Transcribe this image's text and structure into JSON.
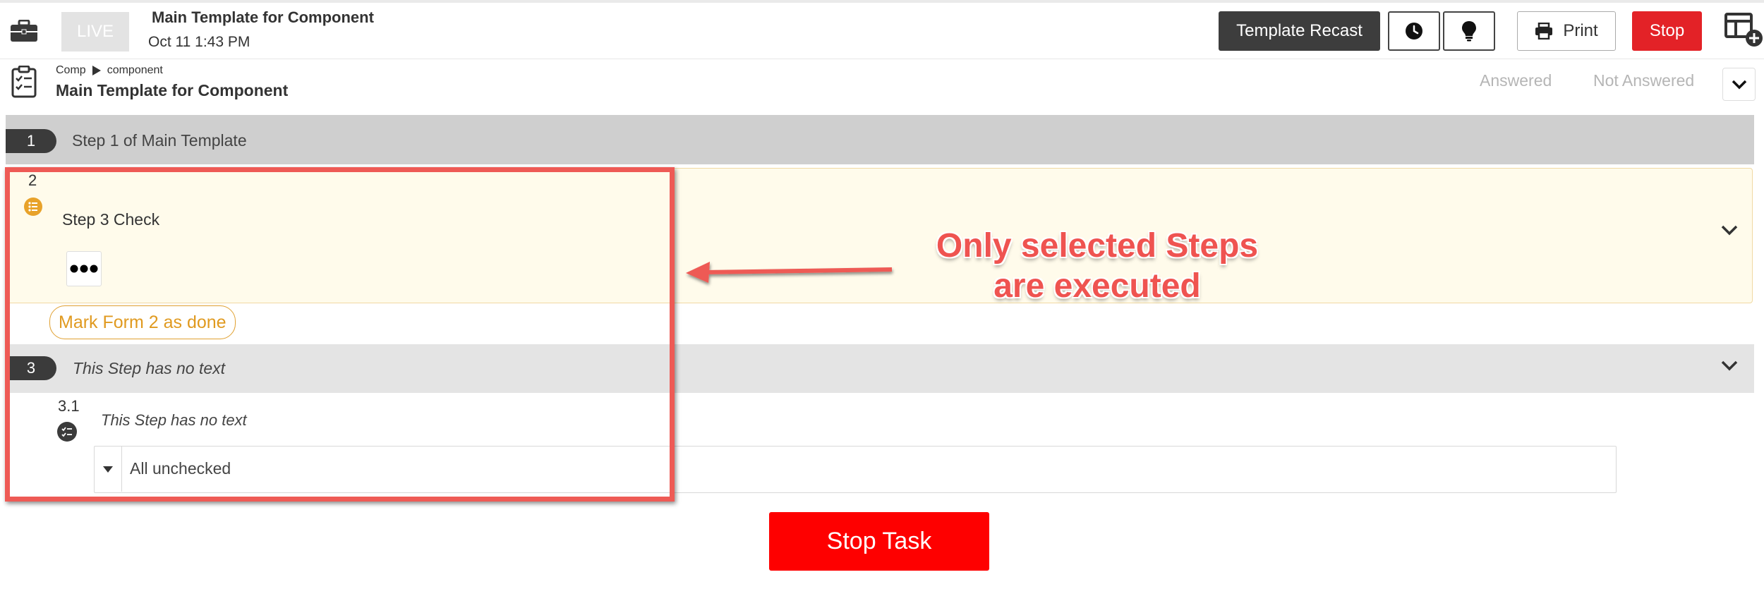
{
  "header": {
    "live_label": "LIVE",
    "title": "Main Template for Component",
    "date": "Oct 11 1:43 PM",
    "recast_label": "Template Recast",
    "print_label": "Print",
    "stop_label": "Stop"
  },
  "subheader": {
    "breadcrumb": {
      "root": "Comp",
      "child": "component"
    },
    "title": "Main Template for Component",
    "answered_label": "Answered",
    "not_answered_label": "Not Answered"
  },
  "steps": {
    "step1": {
      "number": "1",
      "text": "Step 1 of Main Template"
    },
    "step2": {
      "number": "2",
      "text": "Step 3 Check",
      "mark_done_label": "Mark Form 2 as done"
    },
    "step3": {
      "number": "3",
      "text": "This Step has no text"
    },
    "step31": {
      "number": "3.1",
      "text": "This Step has no text",
      "select_value": "All unchecked"
    }
  },
  "footer": {
    "stop_task_label": "Stop Task"
  },
  "annotation": {
    "line1": "Only selected Steps",
    "line2": "are executed"
  },
  "colors": {
    "stop_red": "#e32227",
    "stop_task_red": "#fe0000",
    "annotation_red": "#ef5350",
    "step2_accent": "#e09a20"
  },
  "icons": [
    "briefcase-icon",
    "clock-icon",
    "lightbulb-icon",
    "printer-icon",
    "layout-add-icon",
    "clipboard-icon",
    "play-icon",
    "chevron-down-icon",
    "list-icon",
    "checklist-icon",
    "caret-down-icon",
    "ellipsis-icon",
    "arrow-left-icon"
  ]
}
